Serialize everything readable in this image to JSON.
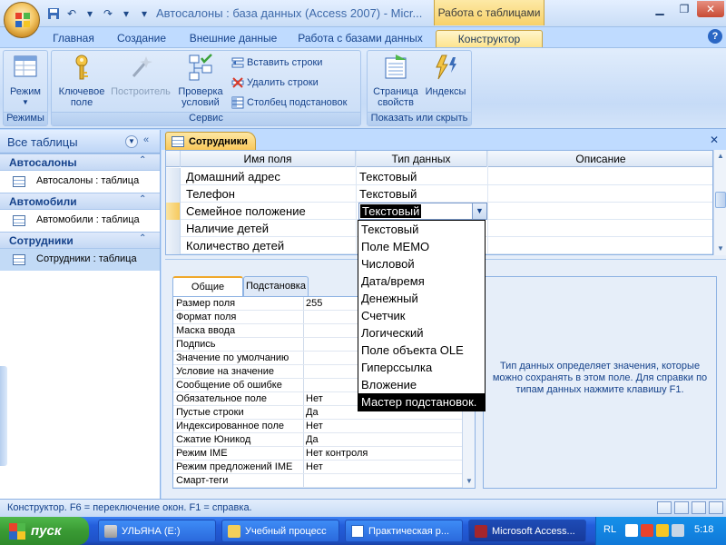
{
  "window": {
    "title": "Автосалоны : база данных (Access 2007) - Micr...",
    "context_tab_title": "Работа с таблицами"
  },
  "ribbon": {
    "tabs": [
      "Главная",
      "Создание",
      "Внешние данные",
      "Работа с базами данных",
      "Конструктор"
    ],
    "active_tab": "Конструктор",
    "groups": {
      "modes": {
        "label": "Режимы",
        "view": "Режим"
      },
      "service": {
        "label": "Сервис",
        "key_field": "Ключевое поле",
        "builder": "Построитель",
        "test_rules": "Проверка условий",
        "insert_rows": "Вставить строки",
        "delete_rows": "Удалить строки",
        "lookup_column": "Столбец  подстановок"
      },
      "show_hide": {
        "label": "Показать или скрыть",
        "property_sheet": "Страница свойств",
        "indexes": "Индексы"
      }
    }
  },
  "nav": {
    "header": "Все таблицы",
    "groups": [
      {
        "name": "Автосалоны",
        "item": "Автосалоны : таблица"
      },
      {
        "name": "Автомобили",
        "item": "Автомобили : таблица"
      },
      {
        "name": "Сотрудники",
        "item": "Сотрудники : таблица"
      }
    ]
  },
  "document": {
    "tab": "Сотрудники",
    "columns": {
      "field_name": "Имя поля",
      "data_type": "Тип данных",
      "description": "Описание"
    },
    "rows": [
      {
        "name": "Домашний адрес",
        "type": "Текстовый"
      },
      {
        "name": "Телефон",
        "type": "Текстовый"
      },
      {
        "name": "Семейное положение",
        "type": "Текстовый"
      },
      {
        "name": "Наличие детей",
        "type": ""
      },
      {
        "name": "Количество детей",
        "type": ""
      }
    ],
    "current_type_value": "Текстовый",
    "type_options": [
      "Текстовый",
      "Поле MEMO",
      "Числовой",
      "Дата/время",
      "Денежный",
      "Счетчик",
      "Логический",
      "Поле объекта OLE",
      "Гиперссылка",
      "Вложение",
      "Мастер подстановок."
    ],
    "highlighted_option": "Мастер подстановок."
  },
  "properties": {
    "tabs": [
      "Общие",
      "Подстановка"
    ],
    "rows": [
      {
        "name": "Размер поля",
        "value": "255"
      },
      {
        "name": "Формат поля",
        "value": ""
      },
      {
        "name": "Маска ввода",
        "value": ""
      },
      {
        "name": "Подпись",
        "value": ""
      },
      {
        "name": "Значение по умолчанию",
        "value": ""
      },
      {
        "name": "Условие на значение",
        "value": ""
      },
      {
        "name": "Сообщение об ошибке",
        "value": ""
      },
      {
        "name": "Обязательное поле",
        "value": "Нет"
      },
      {
        "name": "Пустые строки",
        "value": "Да"
      },
      {
        "name": "Индексированное поле",
        "value": "Нет"
      },
      {
        "name": "Сжатие Юникод",
        "value": "Да"
      },
      {
        "name": "Режим IME",
        "value": "Нет контроля"
      },
      {
        "name": "Режим предложений IME",
        "value": "Нет"
      },
      {
        "name": "Смарт-теги",
        "value": ""
      }
    ],
    "help_text": "Тип данных определяет значения, которые можно сохранять в этом поле.  Для справки по типам данных нажмите клавишу F1."
  },
  "status_bar": {
    "text": "Конструктор.  F6 = переключение окон.  F1 = справка."
  },
  "taskbar": {
    "start": "пуск",
    "tasks": [
      "УЛЬЯНА (E:)",
      "Учебный процесс",
      "Практическая р...",
      "Microsoft Access..."
    ],
    "active_task": "Microsoft Access...",
    "lang": "RL",
    "clock": "5:18"
  },
  "colors": {
    "ribbon_bg": "#bfdbff",
    "accent": "#f9c85a",
    "taskbar": "#245edb",
    "start": "#3a9a34"
  }
}
